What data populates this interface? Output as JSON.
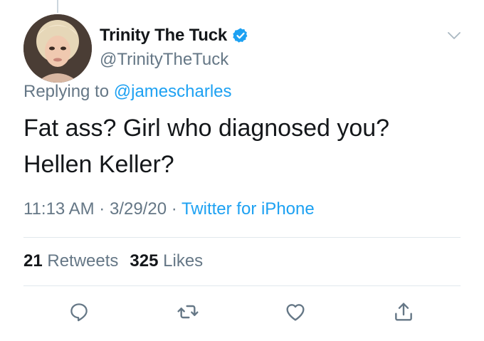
{
  "tweet": {
    "display_name": "Trinity The Tuck",
    "handle": "@TrinityTheTuck",
    "replying_prefix": "Replying to ",
    "replying_to": "@jamescharles",
    "text_lines": [
      "Fat ass? Girl who diagnosed you?",
      "Hellen Keller?"
    ],
    "time": "11:13 AM",
    "date": "3/29/20",
    "separator": "·",
    "source": "Twitter for iPhone",
    "retweets_count": "21",
    "retweets_label": "Retweets",
    "likes_count": "325",
    "likes_label": "Likes",
    "verified": true
  },
  "actions": {
    "reply_icon": "reply-icon",
    "retweet_icon": "retweet-icon",
    "like_icon": "like-icon",
    "share_icon": "share-icon"
  },
  "colors": {
    "link": "#1da1f2",
    "secondary_text": "#657786",
    "primary_text": "#14171a",
    "divider": "#e1e8ed",
    "verified_badge": "#1da1f2"
  }
}
